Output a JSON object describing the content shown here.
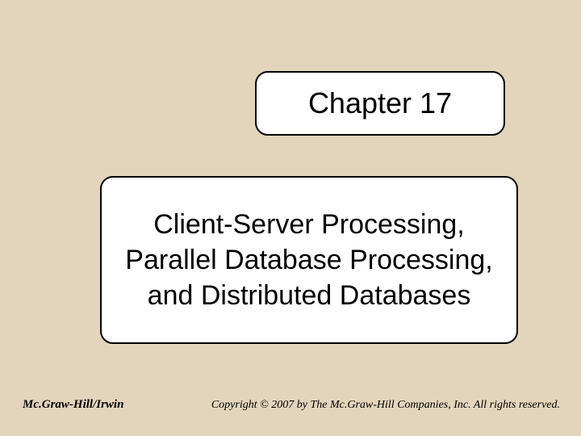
{
  "slide": {
    "chapter_title": "Chapter 17",
    "subtitle": "Client-Server Processing, Parallel Database Processing, and Distributed Databases",
    "footer_left": "Mc.Graw-Hill/Irwin",
    "footer_right": "Copyright © 2007 by The Mc.Graw-Hill Companies, Inc. All rights reserved."
  }
}
